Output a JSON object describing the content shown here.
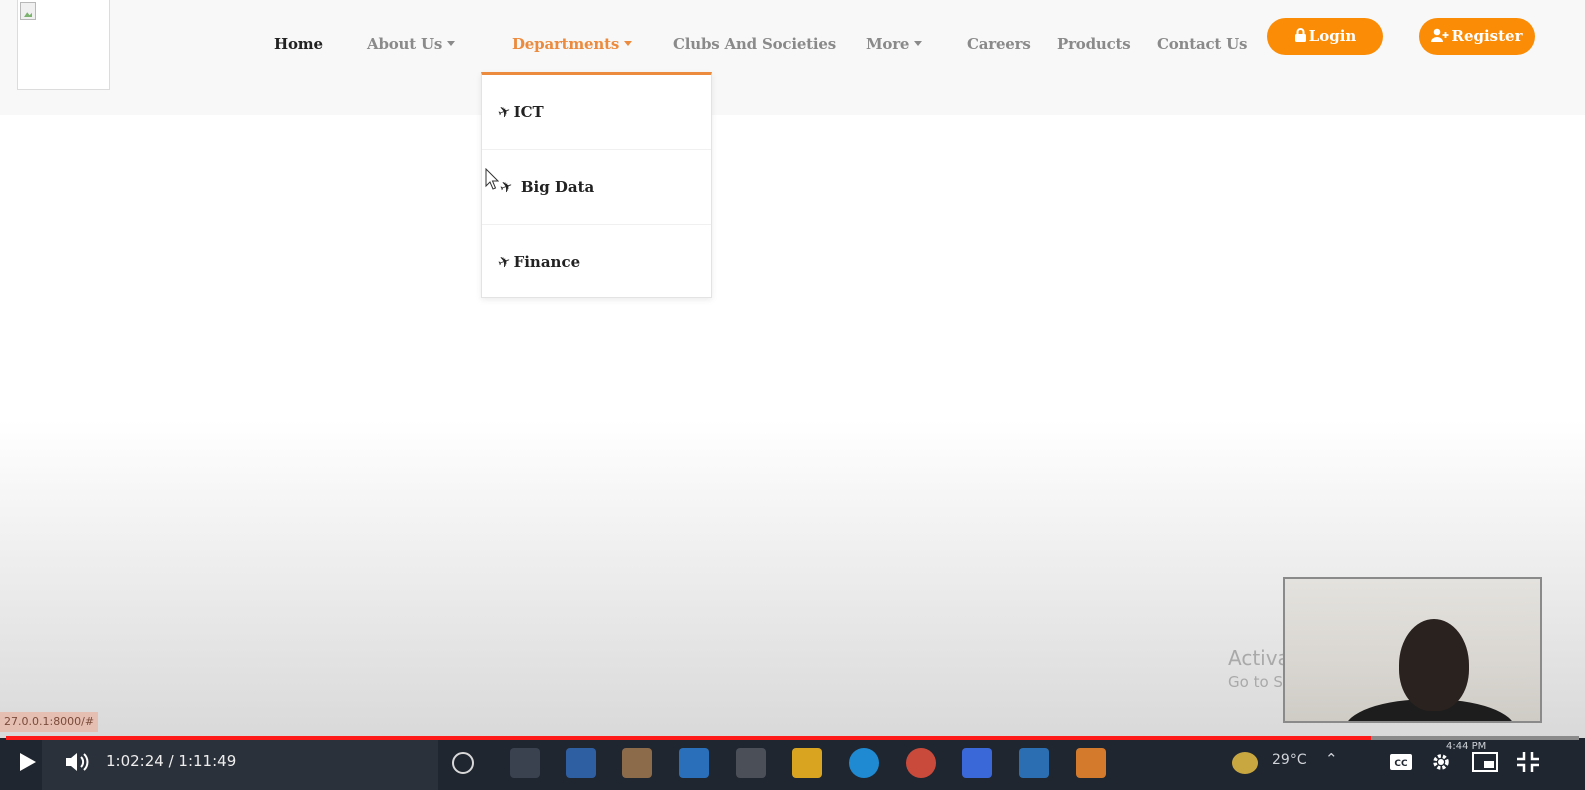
{
  "nav": {
    "home": "Home",
    "about": "About Us",
    "departments": "Departments",
    "clubs": "Clubs And Societies",
    "more": "More",
    "careers": "Careers",
    "products": "Products",
    "contact": "Contact Us",
    "login": "Login",
    "register": "Register"
  },
  "dropdown": {
    "items": [
      {
        "label": "ICT"
      },
      {
        "label": "Big Data"
      },
      {
        "label": "Finance"
      }
    ]
  },
  "colors": {
    "accent": "#fb8c06",
    "active_dropdown": "#ec8b3e",
    "progress": "#ff1a1a"
  },
  "icons": {
    "dropdown_item": "paper-plane-icon",
    "login": "lock-icon",
    "register": "user-plus-icon"
  },
  "watermark": {
    "title": "Activa",
    "subtitle": "Go to S"
  },
  "status_url": "27.0.0.1:8000/#",
  "player": {
    "time": "1:02:24 / 1:11:49",
    "progress_fraction": 0.868,
    "buffered_fraction": 0.86
  },
  "tray": {
    "temperature": "29°C",
    "clock": "4:44 PM"
  }
}
